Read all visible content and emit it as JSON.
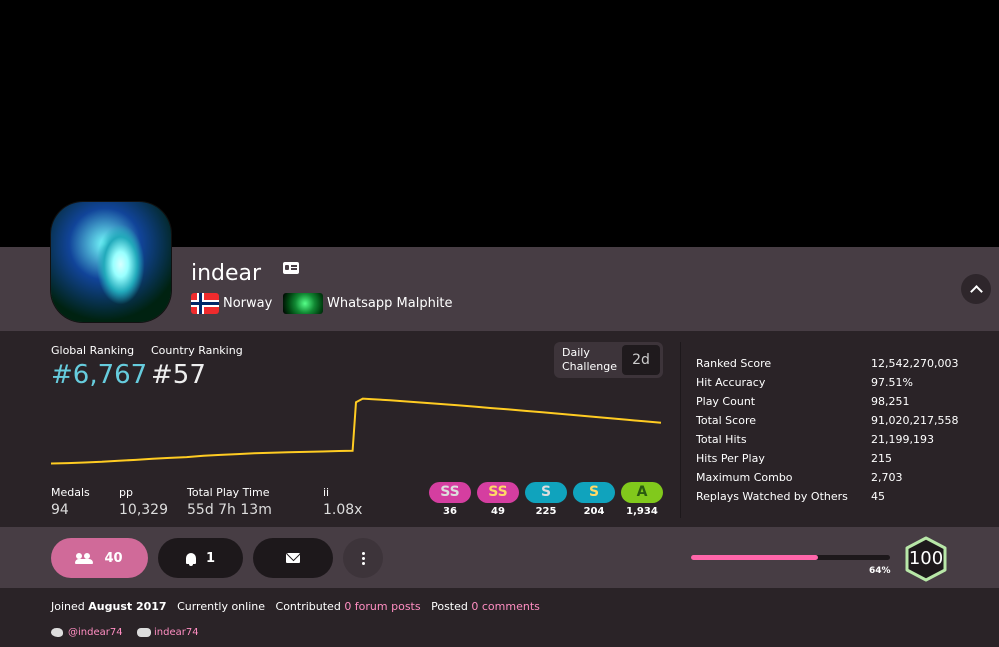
{
  "profile": {
    "username": "indear",
    "country": "Norway",
    "team": "Whatsapp Malphite"
  },
  "rankings": {
    "global_label": "Global Ranking",
    "global_value": "#6,767",
    "country_label": "Country Ranking",
    "country_value": "#57"
  },
  "daily_challenge": {
    "label_line1": "Daily",
    "label_line2": "Challenge",
    "value": "2d"
  },
  "chart_data": {
    "type": "line",
    "x": [
      0,
      5,
      10,
      15,
      20,
      25,
      30,
      35,
      40,
      45,
      50,
      55,
      60,
      65,
      70,
      75,
      80,
      85,
      89,
      90,
      92,
      95,
      100,
      105,
      110,
      115,
      120,
      125,
      130,
      135,
      140,
      145,
      150,
      155,
      160,
      165,
      170,
      175,
      180
    ],
    "y": [
      9340,
      9320,
      9290,
      9260,
      9210,
      9170,
      9120,
      9080,
      9040,
      8980,
      8940,
      8900,
      8860,
      8840,
      8820,
      8800,
      8780,
      8760,
      8750,
      6500,
      6330,
      6360,
      6400,
      6460,
      6520,
      6580,
      6640,
      6700,
      6770,
      6830,
      6900,
      6960,
      7030,
      7100,
      7170,
      7240,
      7310,
      7380,
      7450
    ],
    "ylim": [
      6300,
      9500
    ],
    "color": "#ffcc22"
  },
  "stats_small": [
    {
      "label": "Medals",
      "value": "94"
    },
    {
      "label": "pp",
      "value": "10,329"
    },
    {
      "label": "Total Play Time",
      "value": "55d 7h 13m"
    },
    {
      "label": "ii",
      "value": "1.08x"
    }
  ],
  "grades": [
    {
      "name": "SS",
      "count": "36",
      "bg": "#d53ea0",
      "fg": "#dddddd"
    },
    {
      "name": "SS",
      "count": "49",
      "bg": "#d53ea0",
      "fg": "#ffd966"
    },
    {
      "name": "S",
      "count": "225",
      "bg": "#10a3bd",
      "fg": "#dddddd"
    },
    {
      "name": "S",
      "count": "204",
      "bg": "#10a3bd",
      "fg": "#ffd966"
    },
    {
      "name": "A",
      "count": "1,934",
      "bg": "#81c91c",
      "fg": "#2a5a10"
    }
  ],
  "stats_detail": [
    {
      "label": "Ranked Score",
      "value": "12,542,270,003"
    },
    {
      "label": "Hit Accuracy",
      "value": "97.51%"
    },
    {
      "label": "Play Count",
      "value": "98,251"
    },
    {
      "label": "Total Score",
      "value": "91,020,217,558"
    },
    {
      "label": "Total Hits",
      "value": "21,199,193"
    },
    {
      "label": "Hits Per Play",
      "value": "215"
    },
    {
      "label": "Maximum Combo",
      "value": "2,703"
    },
    {
      "label": "Replays Watched by Others",
      "value": "45"
    }
  ],
  "actions": {
    "friends_count": "40",
    "notifications_count": "1"
  },
  "level": {
    "value": "100",
    "progress_label": "64%",
    "progress": 0.64
  },
  "info": {
    "joined_prefix": "Joined",
    "joined_date": "August 2017",
    "online": "Currently online",
    "contributed_prefix": "Contributed",
    "forum_posts": "0 forum posts",
    "posted_prefix": "Posted",
    "comments": "0 comments"
  },
  "social": {
    "twitter": "@indear74",
    "discord": "indear74"
  }
}
